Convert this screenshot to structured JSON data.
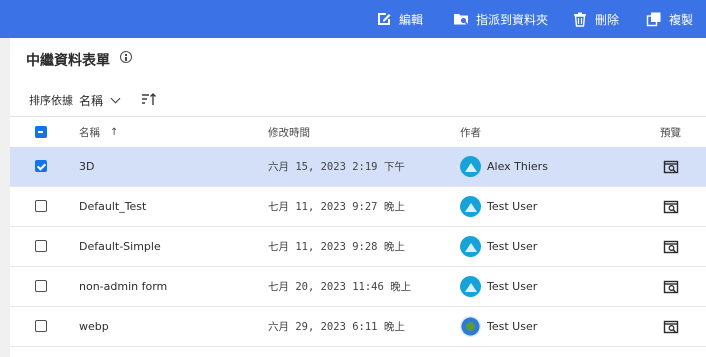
{
  "toolbar": {
    "edit_label": "編輯",
    "assign_label": "指派到資料夾",
    "delete_label": "刪除",
    "copy_label": "複製"
  },
  "page": {
    "title": "中繼資料表單"
  },
  "sort": {
    "label": "排序依據",
    "value": "名稱"
  },
  "table": {
    "headers": {
      "name": "名稱",
      "modified": "修改時間",
      "author": "作者",
      "preview": "預覽"
    },
    "rows": [
      {
        "name": "3D",
        "modified": "六月 15, 2023 2:19 下午",
        "author": "Alex Thiers",
        "selected": true
      },
      {
        "name": "Default_Test",
        "modified": "七月 11, 2023 9:27 晚上",
        "author": "Test User",
        "selected": false
      },
      {
        "name": "Default-Simple",
        "modified": "七月 11, 2023 9:28 晚上",
        "author": "Test User",
        "selected": false
      },
      {
        "name": "non-admin form",
        "modified": "七月 20, 2023 11:46 晚上",
        "author": "Test User",
        "selected": false
      },
      {
        "name": "webp",
        "modified": "六月 29, 2023 6:11 晚上",
        "author": "Test User",
        "selected": false
      }
    ]
  },
  "colors": {
    "topbar": "#3b73e6",
    "selected_row": "#d3e0f7",
    "checkbox_accent": "#1473e6"
  },
  "icons": {
    "edit": "pencil-icon",
    "assign": "folder-icon",
    "delete": "trash-icon",
    "copy": "copy-icon",
    "preview": "preview-icon"
  }
}
